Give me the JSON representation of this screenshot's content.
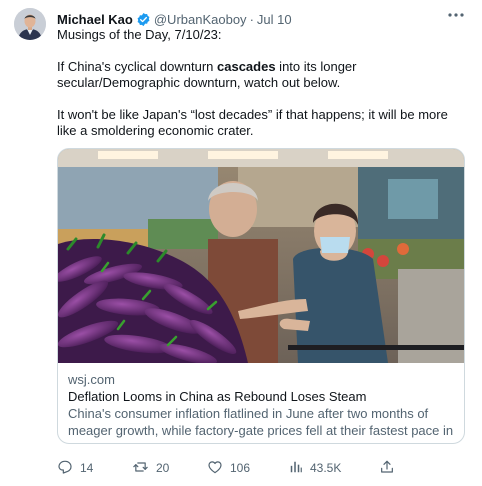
{
  "author": {
    "name": "Michael Kao",
    "handle": "@UrbanKaoboy",
    "separator": "·",
    "date": "Jul 10"
  },
  "tweet": {
    "line1": "Musings of the Day, 7/10/23:",
    "p2_before": "If China's cyclical downturn ",
    "p2_bold": "cascades",
    "p2_after": " into its longer secular/Demographic downturn, watch out below.",
    "p3": "It won't be like Japan's “lost decades” if that happens; it will be more like a smoldering economic crater."
  },
  "card": {
    "domain": "wsj.com",
    "title": "Deflation Looms in China as Rebound Loses Steam",
    "description": "China's consumer inflation flatlined in June after two months of meager growth, while factory-gate prices fell at their fastest pace in ..."
  },
  "actions": {
    "replies": "14",
    "retweets": "20",
    "likes": "106",
    "views": "43.5K"
  },
  "colors": {
    "verified": "#1d9bf0",
    "secondary_text": "#536471",
    "border": "#cfd9de"
  },
  "icons": {
    "verified": "verified-badge-icon",
    "more": "more-horizontal-icon",
    "reply": "reply-icon",
    "retweet": "retweet-icon",
    "like": "heart-icon",
    "views": "bar-chart-icon",
    "share": "share-icon"
  }
}
